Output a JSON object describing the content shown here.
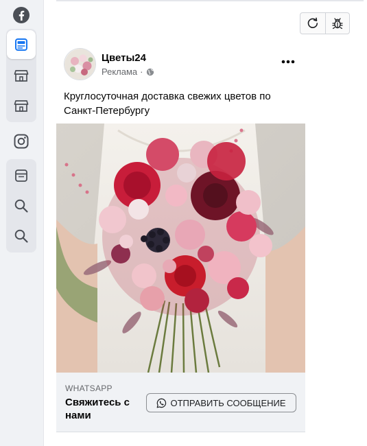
{
  "sidebar": {
    "items": [
      {
        "icon": "facebook-icon"
      },
      {
        "icon": "feed-card-icon",
        "active": true
      },
      {
        "icon": "storefront-icon"
      },
      {
        "icon": "storefront-icon"
      },
      {
        "icon": "instagram-icon"
      },
      {
        "icon": "browser-window-icon"
      },
      {
        "icon": "search-icon"
      },
      {
        "icon": "search-icon"
      }
    ],
    "accent": "#1877f2"
  },
  "toolbar": {
    "refresh_icon": "refresh-icon",
    "debug_icon": "bug-icon"
  },
  "post": {
    "page_name": "Цветы24",
    "sponsored_label": "Реклама",
    "separator": "·",
    "text": "Круглосуточная доставка свежих цветов по Санкт-Петербургу",
    "cta": {
      "caption": "WHATSAPP",
      "title": "Свяжитесь с нами",
      "button_label": "ОТПРАВИТЬ СООБЩЕНИЕ"
    }
  }
}
